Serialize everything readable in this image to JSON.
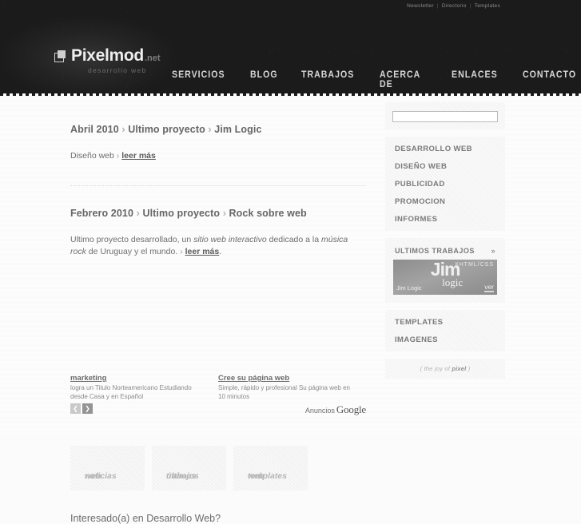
{
  "header": {
    "toplinks": [
      {
        "label": "Newsletter"
      },
      {
        "label": "Directorio"
      },
      {
        "label": "Templates"
      }
    ],
    "separator": "|",
    "logo": {
      "name": "Pixelmod",
      "tld": ".net",
      "tagline": "desarrollo web"
    },
    "nav": [
      {
        "label": "SERVICIOS"
      },
      {
        "label": "BLOG"
      },
      {
        "label": "TRABAJOS"
      },
      {
        "label": "ACERCA DE"
      },
      {
        "label": "ENLACES"
      },
      {
        "label": "CONTACTO"
      }
    ],
    "bg_color": "#1b1b1b"
  },
  "content": {
    "posts": [
      {
        "date": "Abril 2010",
        "kicker": "Ultimo proyecto",
        "title": "Jim Logic",
        "body_pre": "Diseño web",
        "body_mid": "",
        "more": "leer más",
        "body_post": ""
      },
      {
        "date": "Febrero 2010",
        "kicker": "Ultimo proyecto",
        "title": "Rock sobre web",
        "body_pre": "Ultimo proyecto desarrollado, un ",
        "italic1": "sitio web interactivo",
        "body_mid": " dedicado a la ",
        "italic2": "música rock",
        "body_mid2": " de Uruguay y el mundo. ",
        "more": "leer más",
        "body_post": "."
      }
    ],
    "arrow": "›"
  },
  "ads": {
    "items": [
      {
        "title": "marketing",
        "text": "logra un Titulo Norteamericano Estudiando desde Casa y en Español"
      },
      {
        "title": "Cree su página web",
        "text": "Simple, rápido y profesional Su página web en 10 minutos"
      }
    ],
    "prev_icon": "❮",
    "next_icon": "❯",
    "brand_prefix": "Anuncios",
    "brand_name": "Google"
  },
  "promos": [
    {
      "line1": "noticias",
      "line2": "web"
    },
    {
      "line1": "últimos",
      "line2": "trabajos"
    },
    {
      "line1": "templates",
      "line2": "web"
    }
  ],
  "bottom": {
    "heading": "Interesado(a) en Desarrollo Web?"
  },
  "sidebar": {
    "search": {
      "value": "",
      "placeholder": ""
    },
    "menu": [
      {
        "label": "DESARROLLO WEB"
      },
      {
        "label": "DISEÑO WEB"
      },
      {
        "label": "PUBLICIDAD"
      },
      {
        "label": "PROMOCION"
      },
      {
        "label": "INFORMES"
      }
    ],
    "works": {
      "heading": "ULTIMOS TRABAJOS",
      "chevron": "»",
      "thumb": {
        "big": "Jim",
        "small": "logic",
        "tech": "XHTML/CSS",
        "label": "Jim Logic",
        "cta": "ver"
      }
    },
    "links": [
      {
        "label": "TEMPLATES"
      },
      {
        "label": "IMAGENES"
      }
    ],
    "tagline_open": "( the joy of ",
    "tagline_bold": "pixel",
    "tagline_close": " )"
  }
}
